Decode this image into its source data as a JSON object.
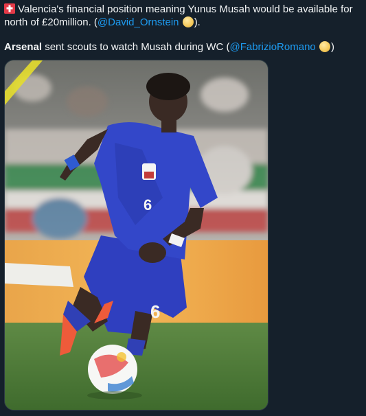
{
  "tweet": {
    "line1_text": "Valencia's financial position meaning Yunus Musah would be available for",
    "line2_before": "north of £20million. (",
    "line2_mention": "@David_Ornstein",
    "line2_after": ").",
    "line3_bold": "Arsenal",
    "line3_text": " sent scouts to watch Musah during WC (",
    "line3_mention": "@FabrizioRomano",
    "line3_after": ")",
    "line1_icon": "flag-icon",
    "coin_icon": "yellow-circle-emoji-icon"
  },
  "media": {
    "alt": "USA player wearing number 6 dribbling a football"
  },
  "colors": {
    "background": "#15202b",
    "text": "#f2f4f5",
    "mention": "#1d9bf0",
    "jersey": "#3347c9"
  }
}
